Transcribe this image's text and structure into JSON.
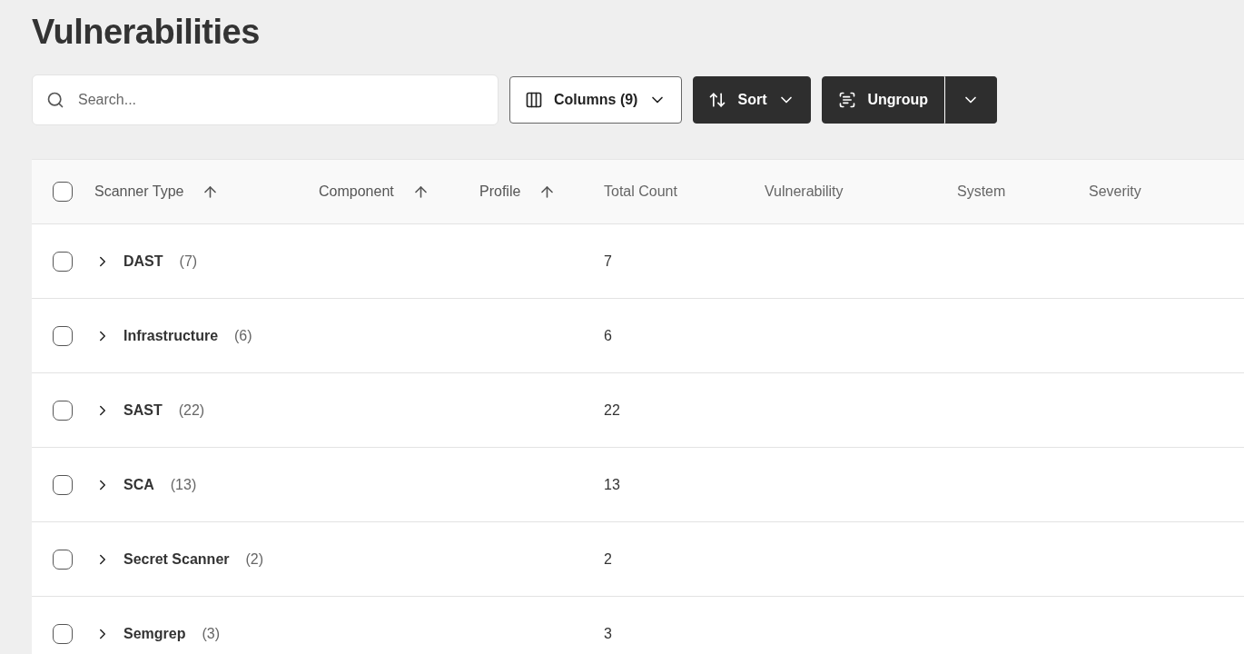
{
  "title": "Vulnerabilities",
  "toolbar": {
    "search": {
      "placeholder": "Search..."
    },
    "columns_button": "Columns (9)",
    "sort_button": "Sort",
    "ungroup_button": "Ungroup"
  },
  "table": {
    "select_all": {
      "checked": false
    },
    "columns": [
      {
        "label": "Scanner Type",
        "sorted": true
      },
      {
        "label": "Component",
        "sorted": true
      },
      {
        "label": "Profile",
        "sorted": true
      },
      {
        "label": "Total Count",
        "sorted": false
      },
      {
        "label": "Vulnerability",
        "sorted": false
      },
      {
        "label": "System",
        "sorted": false
      },
      {
        "label": "Severity",
        "sorted": false
      }
    ],
    "rows": [
      {
        "group": "DAST",
        "count": "(7)",
        "total": "7",
        "checked": false,
        "expanded": false
      },
      {
        "group": "Infrastructure",
        "count": "(6)",
        "total": "6",
        "checked": false,
        "expanded": false
      },
      {
        "group": "SAST",
        "count": "(22)",
        "total": "22",
        "checked": false,
        "expanded": false
      },
      {
        "group": "SCA",
        "count": "(13)",
        "total": "13",
        "checked": false,
        "expanded": false
      },
      {
        "group": "Secret Scanner",
        "count": "(2)",
        "total": "2",
        "checked": false,
        "expanded": false
      },
      {
        "group": "Semgrep",
        "count": "(3)",
        "total": "3",
        "checked": false,
        "expanded": false
      }
    ]
  }
}
